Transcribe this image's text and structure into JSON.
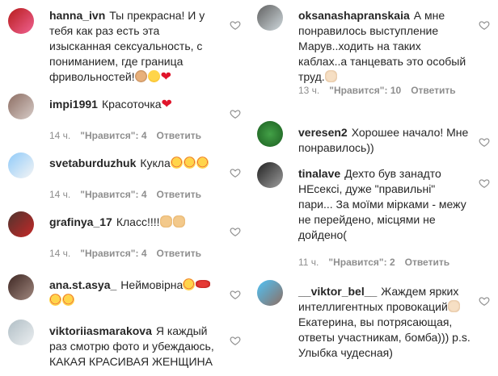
{
  "meta": {
    "likes_label": "\"Нравится\"",
    "reply_label": "Ответить"
  },
  "left": [
    {
      "username": "hanna_ivn",
      "text": "Ты прекрасна! И у тебя как раз есть эта изысканная сексуальность, с пониманием, где граница фривольностей!",
      "emojis": [
        "monkey-emoji",
        "face-emoji",
        "heart-emoji"
      ]
    },
    {
      "username": "impi1991",
      "text": "Красоточка",
      "emojis": [
        "heart-emoji"
      ],
      "time": "14 ч.",
      "likes": "4"
    },
    {
      "username": "svetaburduzhuk",
      "text": "Кукла",
      "emojis": [
        "star-eyes-emoji",
        "star-eyes-emoji",
        "star-eyes-emoji"
      ],
      "time": "14 ч.",
      "likes": "4"
    },
    {
      "username": "grafinya_17",
      "text": "Класс!!!!",
      "emojis": [
        "ok-hand-emoji",
        "ok-hand-emoji"
      ],
      "time": "14 ч.",
      "likes": "4"
    },
    {
      "username": "ana.st.asya_",
      "text": "Неймовірна",
      "emojis": [
        "star-eyes-emoji",
        "kiss-emoji",
        "star-eyes-emoji",
        "star-eyes-emoji"
      ]
    },
    {
      "username": "viktoriiasmarakova",
      "text": "Я каждый раз смотрю фото и убеждаюсь, КАКАЯ КРАСИВАЯ ЖЕНЩИНА",
      "emojis": []
    }
  ],
  "right": [
    {
      "username": "oksanashapranskaia",
      "text": "А мне понравилось выступление Марув..ходить на таких каблах..а танцевать это особый труд.",
      "emojis": [
        "muscle-emoji"
      ],
      "time": "13 ч.",
      "likes": "10"
    },
    {
      "username": "veresen2",
      "text": "Хорошее начало! Мне понравилось))",
      "emojis": []
    },
    {
      "username": "tinalave",
      "text": "Дехто був занадто НЕсексі, дуже \"правильні\" пари... За моїми мірками - межу не перейдено, місцями не дойдено(",
      "emojis": [],
      "time": "11 ч.",
      "likes": "2"
    },
    {
      "username": "__viktor_bel__",
      "text": "Жаждем ярких интеллигентных провокаций",
      "text2": " Екатерина, вы потрясающая, ответы участникам, бомба))) p.s. Улыбка чудесная)",
      "emojis": [
        "muscle-emoji"
      ]
    }
  ],
  "colors": {
    "text": "#262626",
    "secondary": "#8e8e8e",
    "heart_outline": "#8e8e8e",
    "accent_heart": "#e0152b"
  }
}
